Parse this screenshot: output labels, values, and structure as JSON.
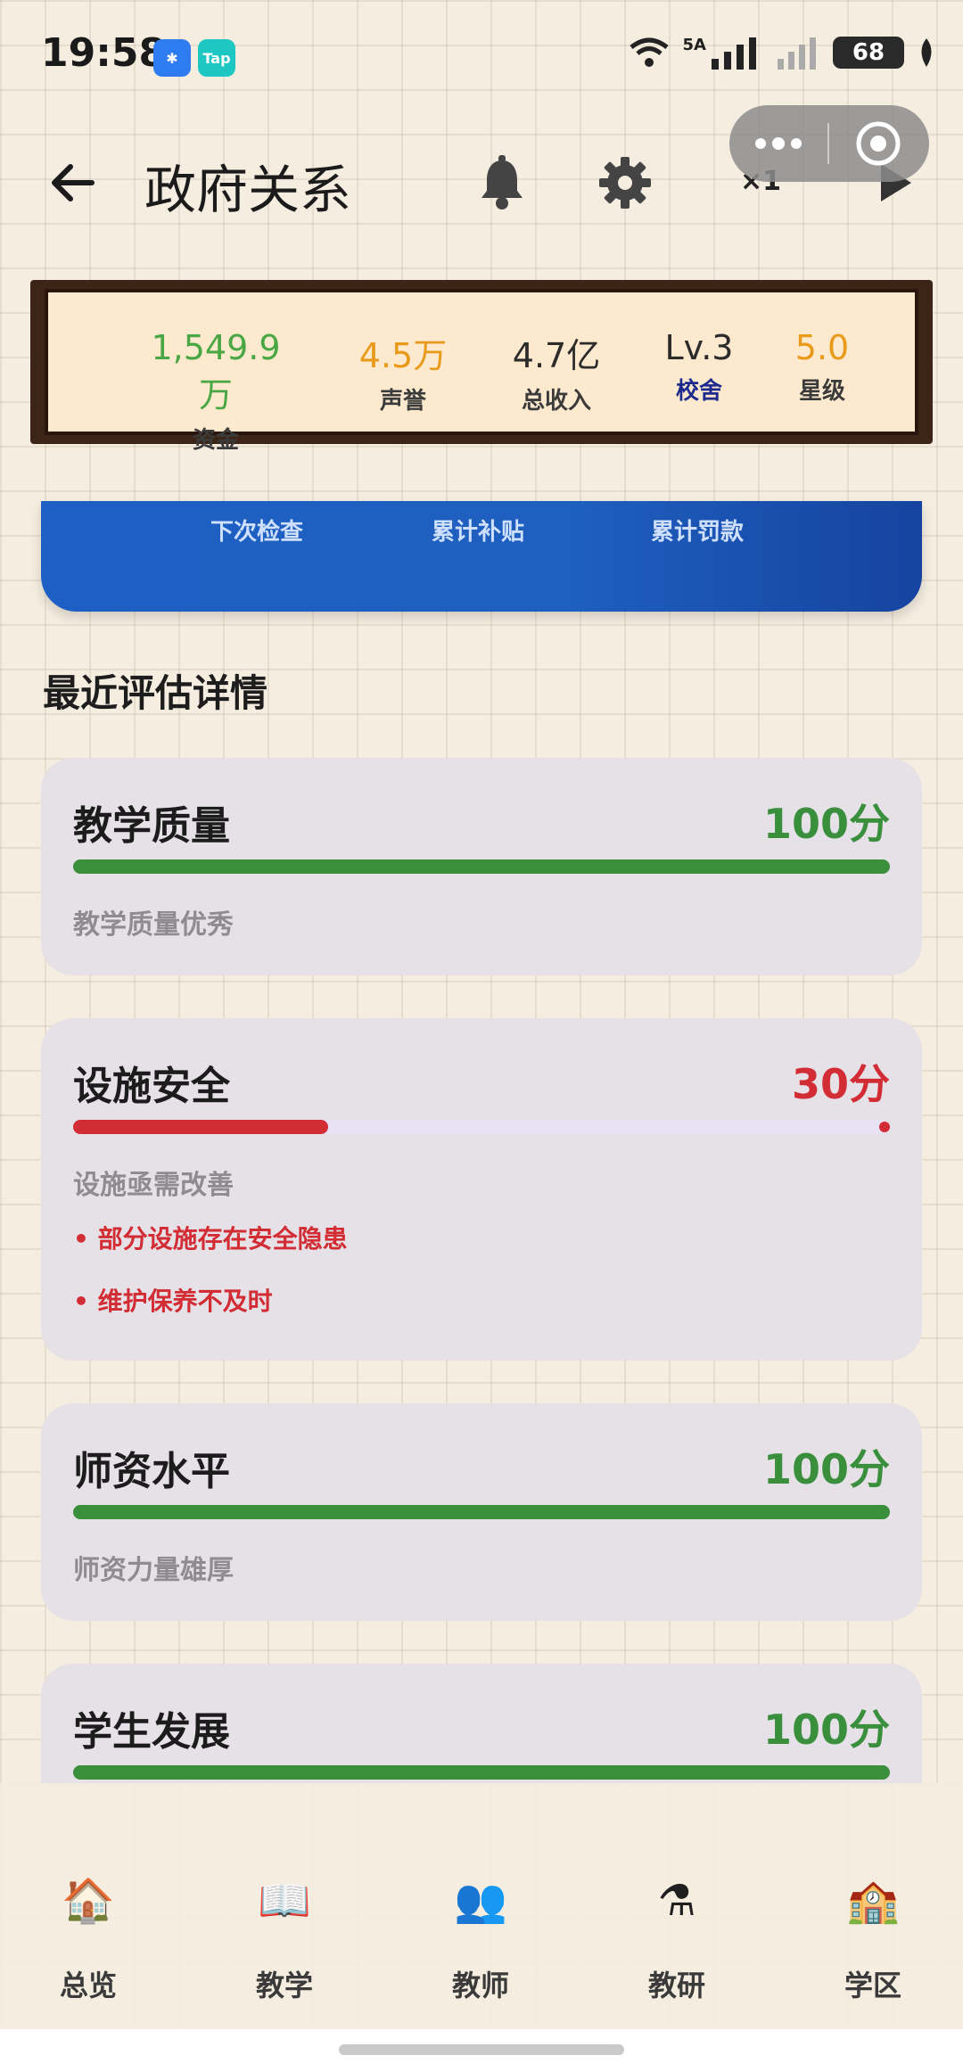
{
  "status_bar": {
    "time": "19:58",
    "badge_tap": "Tap",
    "network": "5A",
    "battery": "68"
  },
  "header": {
    "title": "政府关系",
    "speed": "×1"
  },
  "stats": [
    {
      "value": "1,549.9万",
      "label": "资金",
      "value_color": "#4aa844",
      "label_color": "#3b3b3b"
    },
    {
      "value": "4.5万",
      "label": "声誉",
      "value_color": "#e99a1b",
      "label_color": "#3b3b3b"
    },
    {
      "value": "4.7亿",
      "label": "总收入",
      "value_color": "#2b2b2b",
      "label_color": "#3b3b3b"
    },
    {
      "value": "Lv.3",
      "label": "校舍",
      "value_color": "#2b2b2b",
      "label_color": "#1d2b8f"
    },
    {
      "value": "5.0",
      "label": "星级",
      "value_color": "#e99a1b",
      "label_color": "#3b3b3b"
    }
  ],
  "banner": {
    "next_inspection": "下次检查",
    "total_subsidy": "累计补贴",
    "total_fine": "累计罚款"
  },
  "section_title": "最近评估详情",
  "evaluations": [
    {
      "title": "教学质量",
      "score": "100分",
      "score_value": 100,
      "color": "#3a8f3d",
      "desc": "教学质量优秀",
      "issues": []
    },
    {
      "title": "设施安全",
      "score": "30分",
      "score_value": 30,
      "color": "#d22d34",
      "desc": "设施亟需改善",
      "issues": [
        "部分设施存在安全隐患",
        "维护保养不及时"
      ]
    },
    {
      "title": "师资水平",
      "score": "100分",
      "score_value": 100,
      "color": "#3a8f3d",
      "desc": "师资力量雄厚",
      "issues": []
    },
    {
      "title": "学生发展",
      "score": "100分",
      "score_value": 100,
      "color": "#3a8f3d",
      "desc": "",
      "issues": []
    }
  ],
  "bottom_nav": [
    {
      "label": "总览",
      "icon": "school-house-icon"
    },
    {
      "label": "教学",
      "icon": "open-book-icon"
    },
    {
      "label": "教师",
      "icon": "teachers-icon"
    },
    {
      "label": "教研",
      "icon": "flask-icon"
    },
    {
      "label": "学区",
      "icon": "school-building-icon"
    }
  ]
}
